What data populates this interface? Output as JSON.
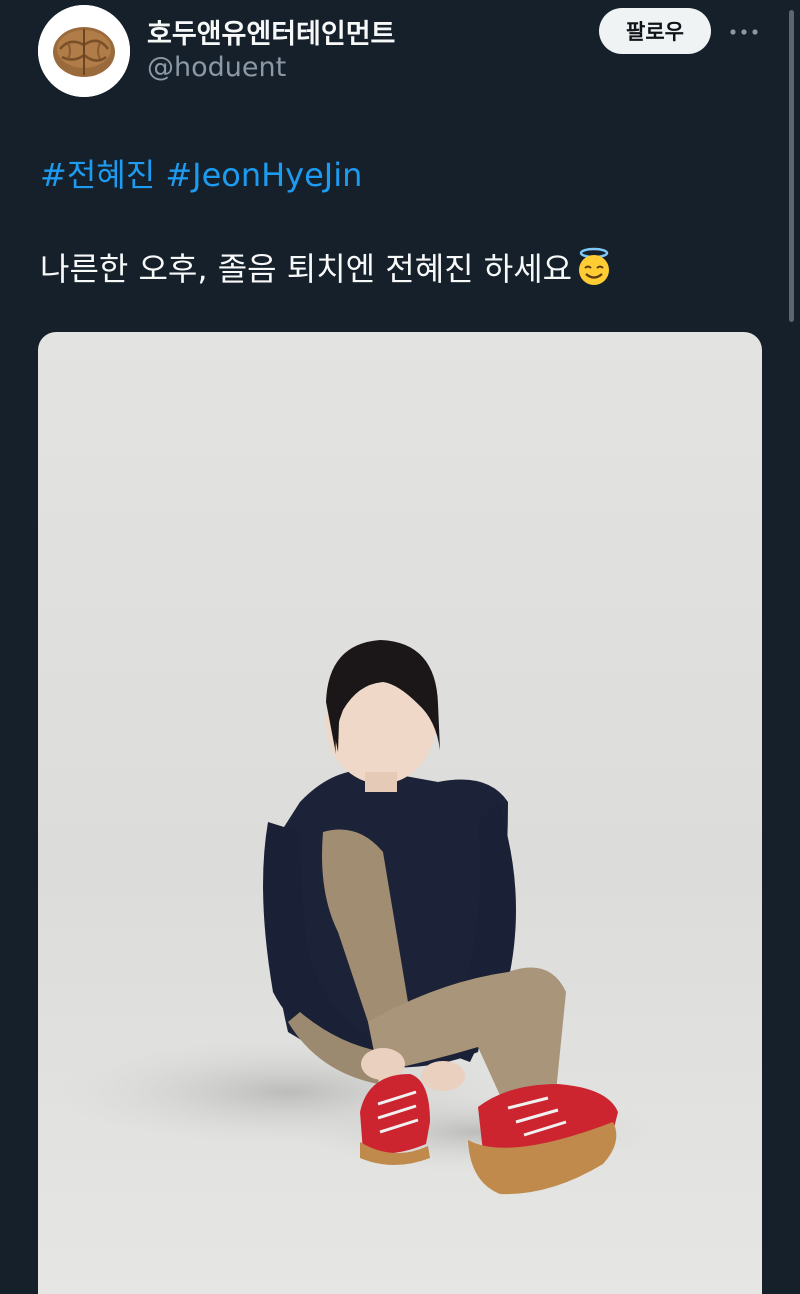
{
  "tweet": {
    "author": {
      "display_name": "호두앤유엔터테인먼트",
      "handle": "@hoduent",
      "avatar_icon": "walnut-icon"
    },
    "follow_label": "팔로우",
    "more_icon": "more-dots-icon",
    "hashtags": [
      "#전혜진",
      "#JeonHyeJin"
    ],
    "text": "나른한 오후, 졸음 퇴치엔 전혜진 하세요",
    "emoji_icon": "smiling-face-with-halo-icon"
  },
  "colors": {
    "background": "#15202b",
    "text": "#f7f9f9",
    "secondary_text": "#8b98a5",
    "link": "#1d9bf0",
    "button_bg": "#eff3f4"
  }
}
